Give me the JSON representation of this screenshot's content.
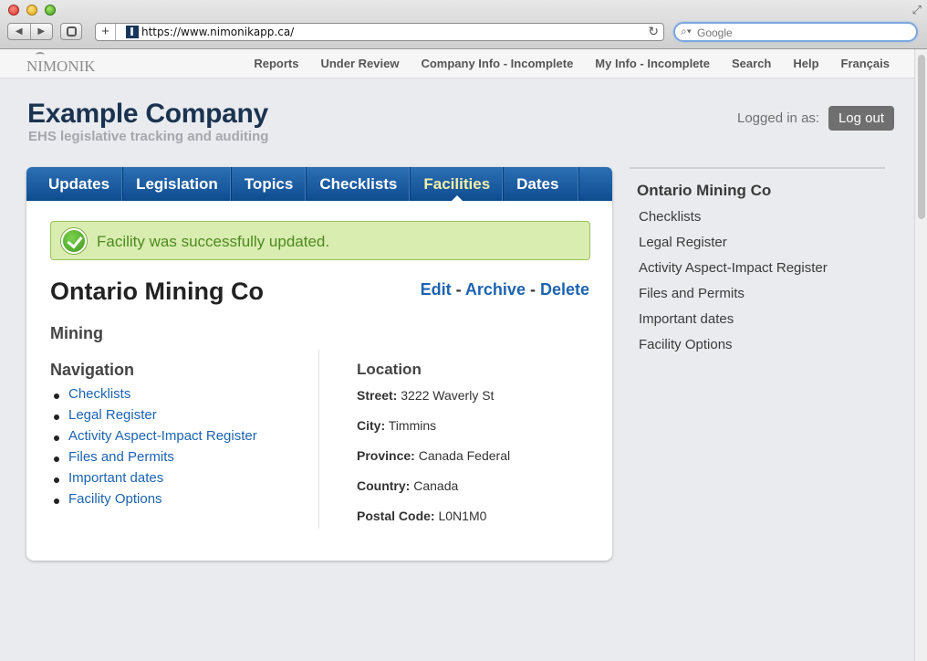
{
  "browser": {
    "url": "https://www.nimonikapp.ca/",
    "search_placeholder": "Google"
  },
  "site_nav": {
    "logo_text": "NIMONIK",
    "items": [
      {
        "label": "Reports"
      },
      {
        "label": "Under Review"
      },
      {
        "label": "Company Info - Incomplete"
      },
      {
        "label": "My Info - Incomplete"
      },
      {
        "label": "Search"
      },
      {
        "label": "Help"
      },
      {
        "label": "Français"
      }
    ]
  },
  "header": {
    "company_name": "Example Company",
    "tagline": "EHS legislative tracking and auditing",
    "logged_in_label": "Logged in as:",
    "logout_label": "Log out"
  },
  "tabs": [
    {
      "label": "Updates"
    },
    {
      "label": "Legislation"
    },
    {
      "label": "Topics"
    },
    {
      "label": "Checklists"
    },
    {
      "label": "Facilities",
      "active": true
    },
    {
      "label": "Dates"
    }
  ],
  "flash": {
    "message": "Facility was successfully updated."
  },
  "facility": {
    "name": "Ontario Mining Co",
    "sector": "Mining",
    "actions": {
      "edit": "Edit",
      "archive": "Archive",
      "delete": "Delete",
      "separator": " - "
    }
  },
  "navigation": {
    "heading": "Navigation",
    "links": [
      {
        "label": "Checklists"
      },
      {
        "label": "Legal Register"
      },
      {
        "label": "Activity Aspect-Impact Register"
      },
      {
        "label": "Files and Permits"
      },
      {
        "label": "Important dates"
      },
      {
        "label": "Facility Options"
      }
    ]
  },
  "location": {
    "heading": "Location",
    "fields": [
      {
        "label": "Street:",
        "value": "3222 Waverly St"
      },
      {
        "label": "City:",
        "value": "Timmins"
      },
      {
        "label": "Province:",
        "value": "Canada Federal"
      },
      {
        "label": "Country:",
        "value": "Canada"
      },
      {
        "label": "Postal Code:",
        "value": "L0N1M0"
      }
    ]
  },
  "sidebar": {
    "title": "Ontario Mining Co",
    "items": [
      {
        "label": "Checklists"
      },
      {
        "label": "Legal Register"
      },
      {
        "label": "Activity Aspect-Impact Register"
      },
      {
        "label": "Files and Permits"
      },
      {
        "label": "Important dates"
      },
      {
        "label": "Facility Options"
      }
    ]
  },
  "colors": {
    "tab_bar": "#1a5ca2",
    "active_tab_text": "#f5f0a8",
    "link": "#1d63b1",
    "flash_bg": "#d9edb0",
    "flash_text": "#4d8a1f",
    "company_title": "#1a3350"
  }
}
